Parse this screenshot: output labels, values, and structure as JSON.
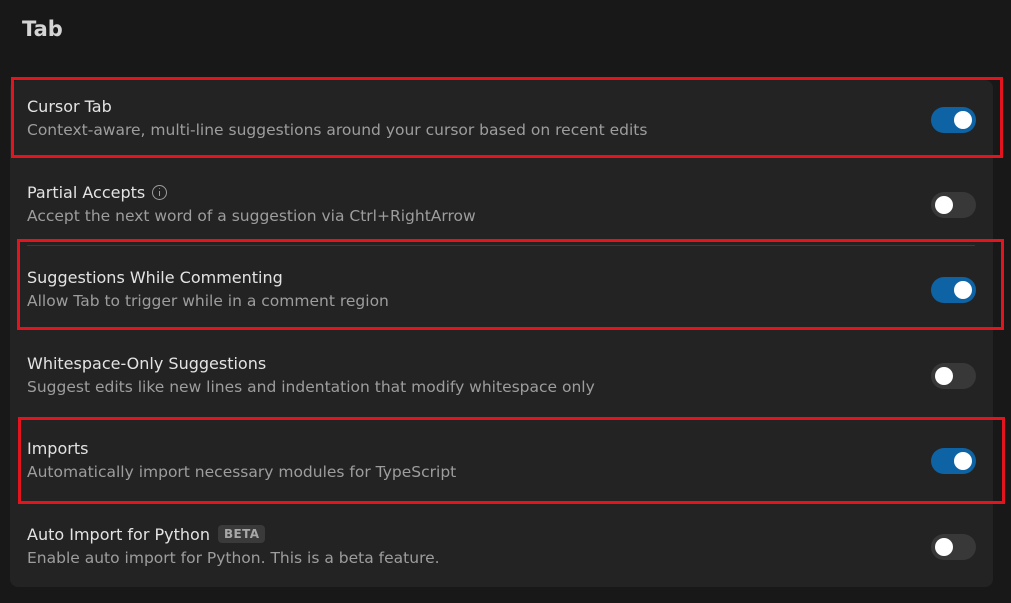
{
  "section": {
    "title": "Tab"
  },
  "settings": [
    {
      "title": "Cursor Tab",
      "description": "Context-aware, multi-line suggestions around your cursor based on recent edits",
      "enabled": true
    },
    {
      "title": "Partial Accepts",
      "description": "Accept the next word of a suggestion via Ctrl+RightArrow",
      "enabled": false,
      "icon": "info-icon"
    },
    {
      "title": "Suggestions While Commenting",
      "description": "Allow Tab to trigger while in a comment region",
      "enabled": true
    },
    {
      "title": "Whitespace-Only Suggestions",
      "description": "Suggest edits like new lines and indentation that modify whitespace only",
      "enabled": false
    },
    {
      "title": "Imports",
      "description": "Automatically import necessary modules for TypeScript",
      "enabled": true
    },
    {
      "title": "Auto Import for Python",
      "badge": "BETA",
      "description": "Enable auto import for Python. This is a beta feature.",
      "enabled": false
    }
  ],
  "colors": {
    "toggle_on": "#0e63a4",
    "toggle_off": "#383838",
    "highlight": "#e3141e"
  }
}
